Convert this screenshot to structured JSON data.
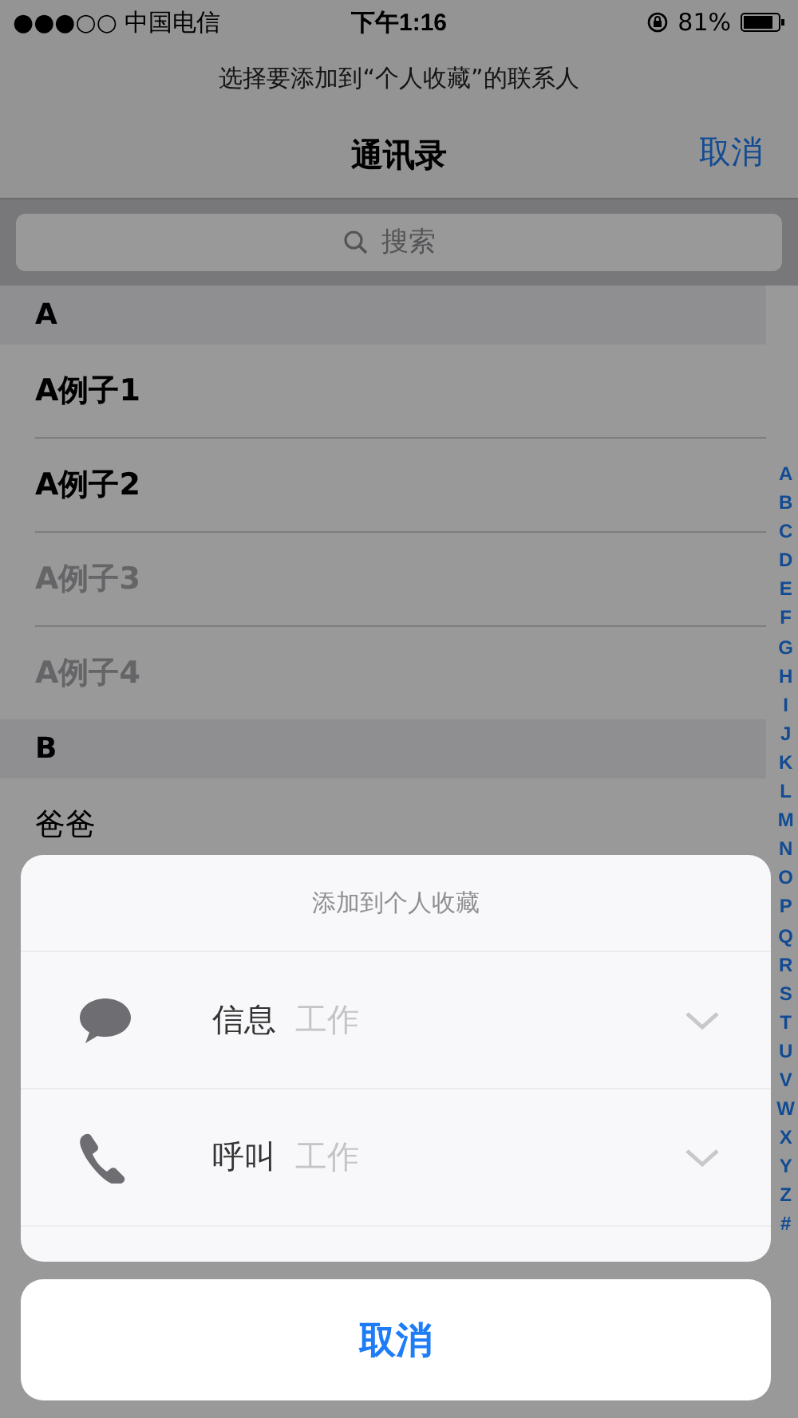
{
  "status_bar": {
    "carrier": "●●●○○ 中国电信",
    "time": "下午1:16",
    "battery": "81%"
  },
  "prompt": "选择要添加到“个人收藏”的联系人",
  "nav": {
    "title": "通讯录",
    "cancel": "取消"
  },
  "search": {
    "placeholder": "搜索"
  },
  "sections": [
    {
      "letter": "A",
      "contacts": [
        {
          "name": "A例子1",
          "bold": true,
          "disabled": false
        },
        {
          "name": "A例子2",
          "bold": true,
          "disabled": false
        },
        {
          "name": "A例子3",
          "bold": true,
          "disabled": true
        },
        {
          "name": "A例子4",
          "bold": true,
          "disabled": true
        }
      ]
    },
    {
      "letter": "B",
      "contacts": [
        {
          "name": "爸爸",
          "bold": false,
          "disabled": false
        }
      ]
    }
  ],
  "index": [
    "A",
    "B",
    "C",
    "D",
    "E",
    "F",
    "G",
    "H",
    "I",
    "J",
    "K",
    "L",
    "M",
    "N",
    "O",
    "P",
    "Q",
    "R",
    "S",
    "T",
    "U",
    "V",
    "W",
    "X",
    "Y",
    "Z",
    "#"
  ],
  "sheet": {
    "title": "添加到个人收藏",
    "actions": [
      {
        "kind": "message",
        "label": "信息",
        "detail": "工作"
      },
      {
        "kind": "call",
        "label": "呼叫",
        "detail": "工作"
      }
    ],
    "cancel": "取消"
  }
}
